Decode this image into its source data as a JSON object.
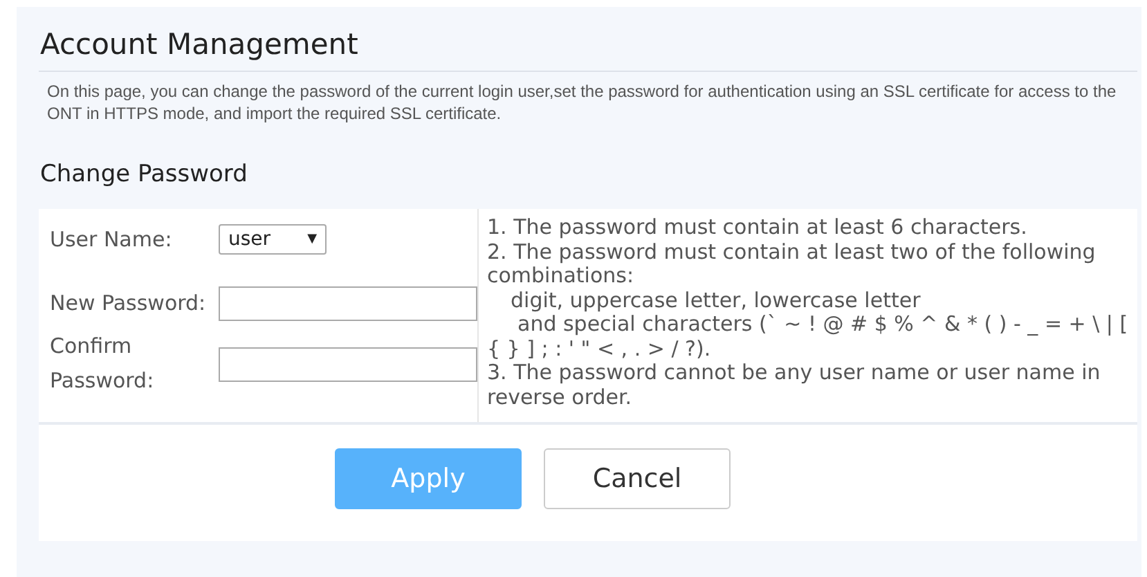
{
  "title": "Account Management",
  "description": "On this page, you can change the password of the current login user,set the password for authentication using an SSL certificate for access to the ONT in HTTPS mode, and import the required SSL certificate.",
  "section_title": "Change Password",
  "fields": [
    {
      "kind": "select",
      "label": "User Name:",
      "value": "user",
      "arrow": "▼"
    },
    {
      "kind": "password",
      "label": "New Password:"
    },
    {
      "kind": "password",
      "label": "Confirm Password:"
    }
  ],
  "rules": [
    {
      "kind": "line",
      "text": "1. The password must contain at least 6 characters."
    },
    {
      "kind": "line",
      "text": "2. The password must contain at least two of the following combinations:"
    },
    {
      "kind": "sub",
      "text": "digit, uppercase letter, lowercase letter"
    },
    {
      "kind": "subwrap",
      "text": "and special characters (` ~ ! @ # $ % ^ & * ( ) - _ = + \\ | [ { } ] ; : ' \" < , . > / ?)."
    },
    {
      "kind": "line",
      "text": "3. The password cannot be any user name or user name in reverse order."
    }
  ],
  "buttons": [
    {
      "label": "Apply",
      "kind": "primary"
    },
    {
      "label": "Cancel",
      "kind": "secondary"
    }
  ]
}
